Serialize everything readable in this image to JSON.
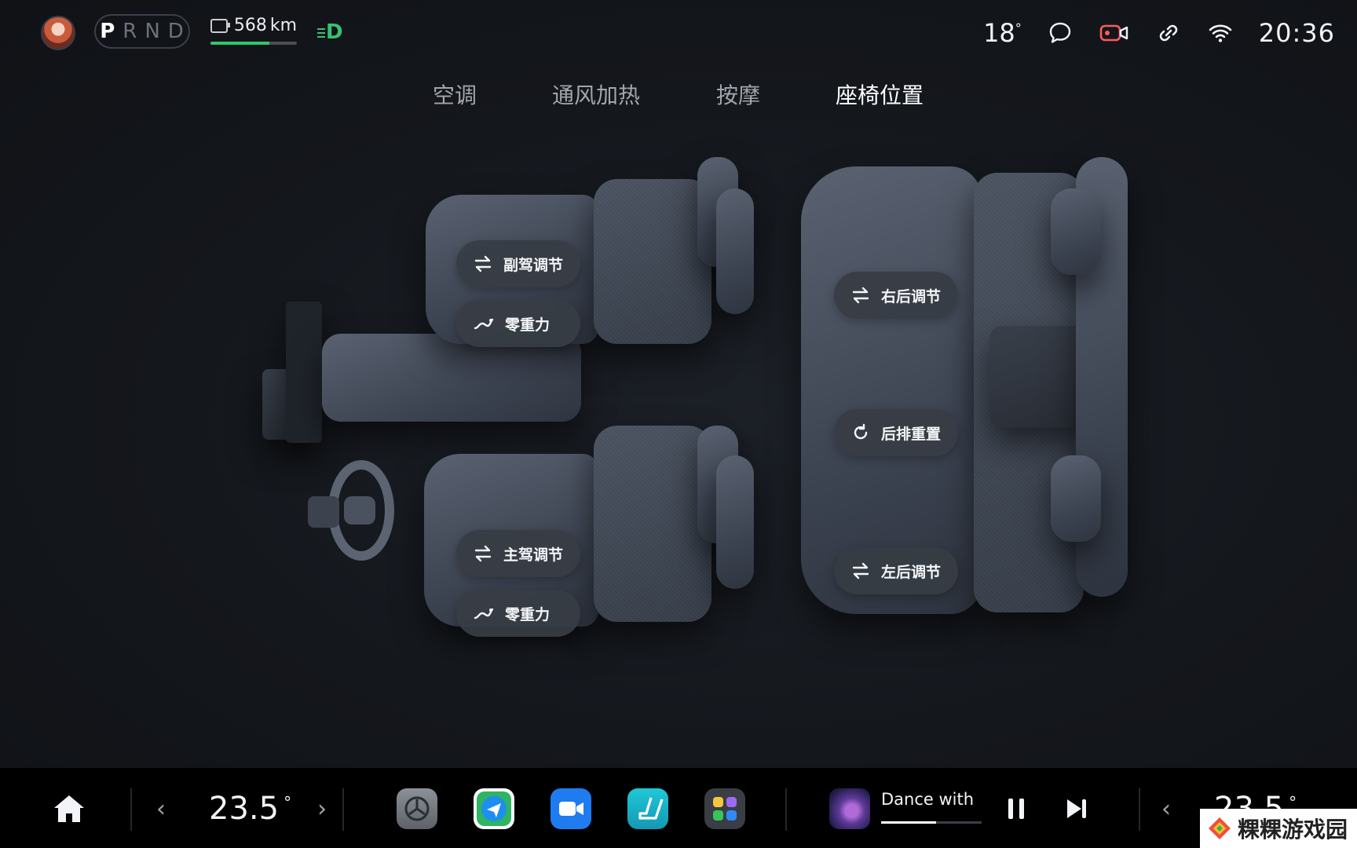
{
  "status_bar": {
    "gears": [
      "P",
      "R",
      "N",
      "D"
    ],
    "active_gear": "P",
    "range_value": "568",
    "range_unit": "km",
    "range_fraction": 0.68,
    "headlight_icon": "headlight-on-icon",
    "outside_temp": "18",
    "temp_unit": "°",
    "icons": [
      "message-icon",
      "camera-icon",
      "link-icon",
      "wifi-icon"
    ],
    "clock": "20:36"
  },
  "tabs": [
    {
      "label": "空调",
      "active": false
    },
    {
      "label": "通风加热",
      "active": false
    },
    {
      "label": "按摩",
      "active": false
    },
    {
      "label": "座椅位置",
      "active": true
    }
  ],
  "seats": {
    "passenger_adjust": "副驾调节",
    "passenger_zero_gravity": "零重力",
    "driver_adjust": "主驾调节",
    "driver_zero_gravity": "零重力",
    "rear_right_adjust": "右后调节",
    "rear_reset": "后排重置",
    "rear_left_adjust": "左后调节"
  },
  "dock": {
    "left_temp": "23.5",
    "right_temp": "23.5",
    "temp_unit": "°",
    "apps": [
      {
        "name": "settings",
        "color": "#6f737a"
      },
      {
        "name": "navigation",
        "color": "#1f8ef1"
      },
      {
        "name": "video-call",
        "color": "#1e7cf0"
      },
      {
        "name": "seat-settings",
        "color": "#18b7c9"
      },
      {
        "name": "app-group",
        "color": "#3a3d44"
      }
    ],
    "media": {
      "title": "Dance with",
      "progress": 0.55
    }
  },
  "watermark": {
    "text": "粿粿游戏园"
  },
  "colors": {
    "accent_green": "#2ec86b",
    "pill_bg": "#373c45",
    "background": "#14171c"
  }
}
